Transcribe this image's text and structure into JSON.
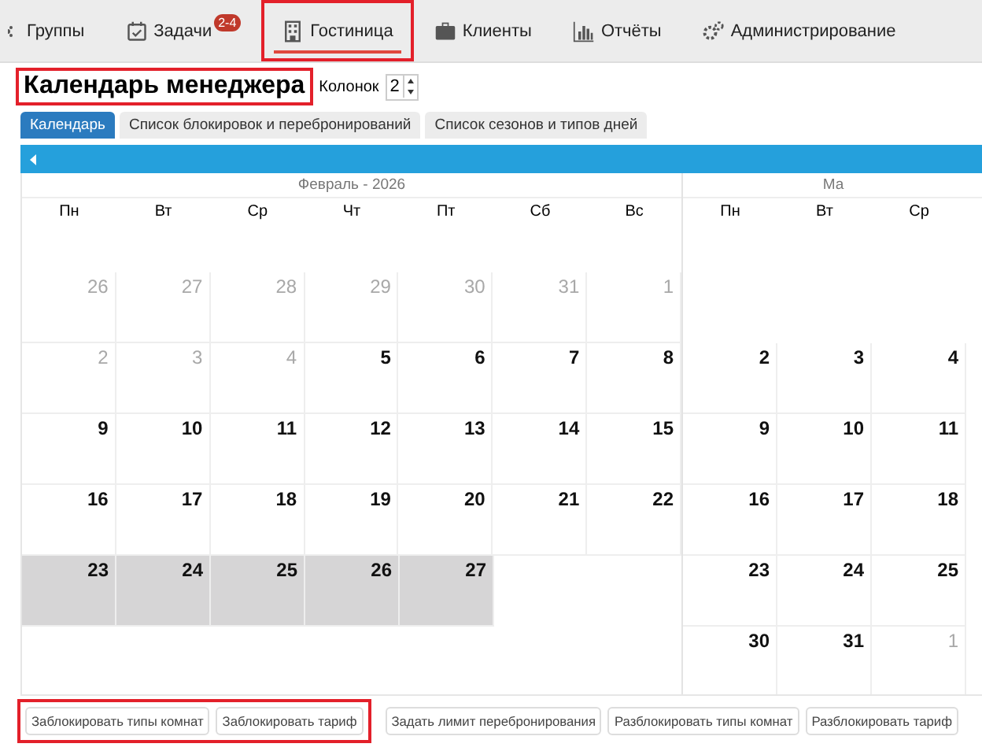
{
  "nav": [
    {
      "label": "Группы",
      "selected": false,
      "highlighted": false
    },
    {
      "label": "Задачи",
      "badge": "2-4",
      "selected": false,
      "highlighted": false
    },
    {
      "label": "Гостиница",
      "selected": true,
      "highlighted": true
    },
    {
      "label": "Клиенты",
      "selected": false,
      "highlighted": false
    },
    {
      "label": "Отчёты",
      "selected": false,
      "highlighted": false
    },
    {
      "label": "Администрирование",
      "selected": false,
      "highlighted": false
    }
  ],
  "title": {
    "text": "Календарь менеджера",
    "highlighted": true
  },
  "columns": {
    "label": "Колонок",
    "value": "2"
  },
  "tabs": [
    {
      "label": "Календарь",
      "selected": true
    },
    {
      "label": "Список блокировок и перебронирований",
      "selected": false
    },
    {
      "label": "Список сезонов и типов дней",
      "selected": false
    }
  ],
  "months": [
    {
      "title": "Февраль - 2026",
      "weekdays": [
        "Пн",
        "Вт",
        "Ср",
        "Чт",
        "Пт",
        "Сб",
        "Вс"
      ],
      "weeks": [
        [
          {
            "day": "26",
            "kind": "other",
            "selected": false
          },
          {
            "day": "27",
            "kind": "other",
            "selected": false
          },
          {
            "day": "28",
            "kind": "other",
            "selected": false
          },
          {
            "day": "29",
            "kind": "other",
            "selected": false
          },
          {
            "day": "30",
            "kind": "other",
            "selected": false
          },
          {
            "day": "31",
            "kind": "other",
            "selected": false
          },
          {
            "day": "1",
            "kind": "other",
            "selected": false
          }
        ],
        [
          {
            "day": "2",
            "kind": "other",
            "selected": false
          },
          {
            "day": "3",
            "kind": "other",
            "selected": false
          },
          {
            "day": "4",
            "kind": "other",
            "selected": false
          },
          {
            "day": "5",
            "kind": "day",
            "selected": false
          },
          {
            "day": "6",
            "kind": "day",
            "selected": false
          },
          {
            "day": "7",
            "kind": "day",
            "selected": false
          },
          {
            "day": "8",
            "kind": "day",
            "selected": false
          }
        ],
        [
          {
            "day": "9",
            "kind": "day",
            "selected": false
          },
          {
            "day": "10",
            "kind": "day",
            "selected": false
          },
          {
            "day": "11",
            "kind": "day",
            "selected": false
          },
          {
            "day": "12",
            "kind": "day",
            "selected": false
          },
          {
            "day": "13",
            "kind": "day",
            "selected": false
          },
          {
            "day": "14",
            "kind": "day",
            "selected": false
          },
          {
            "day": "15",
            "kind": "day",
            "selected": false
          }
        ],
        [
          {
            "day": "16",
            "kind": "day",
            "selected": false
          },
          {
            "day": "17",
            "kind": "day",
            "selected": false
          },
          {
            "day": "18",
            "kind": "day",
            "selected": false
          },
          {
            "day": "19",
            "kind": "day",
            "selected": false
          },
          {
            "day": "20",
            "kind": "day",
            "selected": false
          },
          {
            "day": "21",
            "kind": "day",
            "selected": false
          },
          {
            "day": "22",
            "kind": "day",
            "selected": false
          }
        ],
        [
          {
            "day": "23",
            "kind": "day",
            "selected": true
          },
          {
            "day": "24",
            "kind": "day",
            "selected": true
          },
          {
            "day": "25",
            "kind": "day",
            "selected": true
          },
          {
            "day": "26",
            "kind": "day",
            "selected": true
          },
          {
            "day": "27",
            "kind": "day",
            "selected": true
          }
        ]
      ]
    },
    {
      "title": "Ма",
      "weekdays": [
        "Пн",
        "Вт",
        "Ср"
      ],
      "leading_blank_week": true,
      "weeks": [
        [
          {
            "day": "2",
            "kind": "day",
            "selected": false
          },
          {
            "day": "3",
            "kind": "day",
            "selected": false
          },
          {
            "day": "4",
            "kind": "day",
            "selected": false
          }
        ],
        [
          {
            "day": "9",
            "kind": "day",
            "selected": false
          },
          {
            "day": "10",
            "kind": "day",
            "selected": false
          },
          {
            "day": "11",
            "kind": "day",
            "selected": false
          }
        ],
        [
          {
            "day": "16",
            "kind": "day",
            "selected": false
          },
          {
            "day": "17",
            "kind": "day",
            "selected": false
          },
          {
            "day": "18",
            "kind": "day",
            "selected": false
          }
        ],
        [
          {
            "day": "23",
            "kind": "day",
            "selected": false
          },
          {
            "day": "24",
            "kind": "day",
            "selected": false
          },
          {
            "day": "25",
            "kind": "day",
            "selected": false
          }
        ],
        [
          {
            "day": "30",
            "kind": "day",
            "selected": false
          },
          {
            "day": "31",
            "kind": "day",
            "selected": false
          },
          {
            "day": "1",
            "kind": "other",
            "selected": false
          }
        ]
      ]
    }
  ],
  "button_groups": [
    {
      "highlighted": true,
      "buttons": [
        "Заблокировать типы комнат",
        "Заблокировать тариф"
      ]
    },
    {
      "highlighted": false,
      "buttons": [
        "Задать лимит перебронирования",
        "Разблокировать типы комнат",
        "Разблокировать тариф"
      ]
    }
  ]
}
